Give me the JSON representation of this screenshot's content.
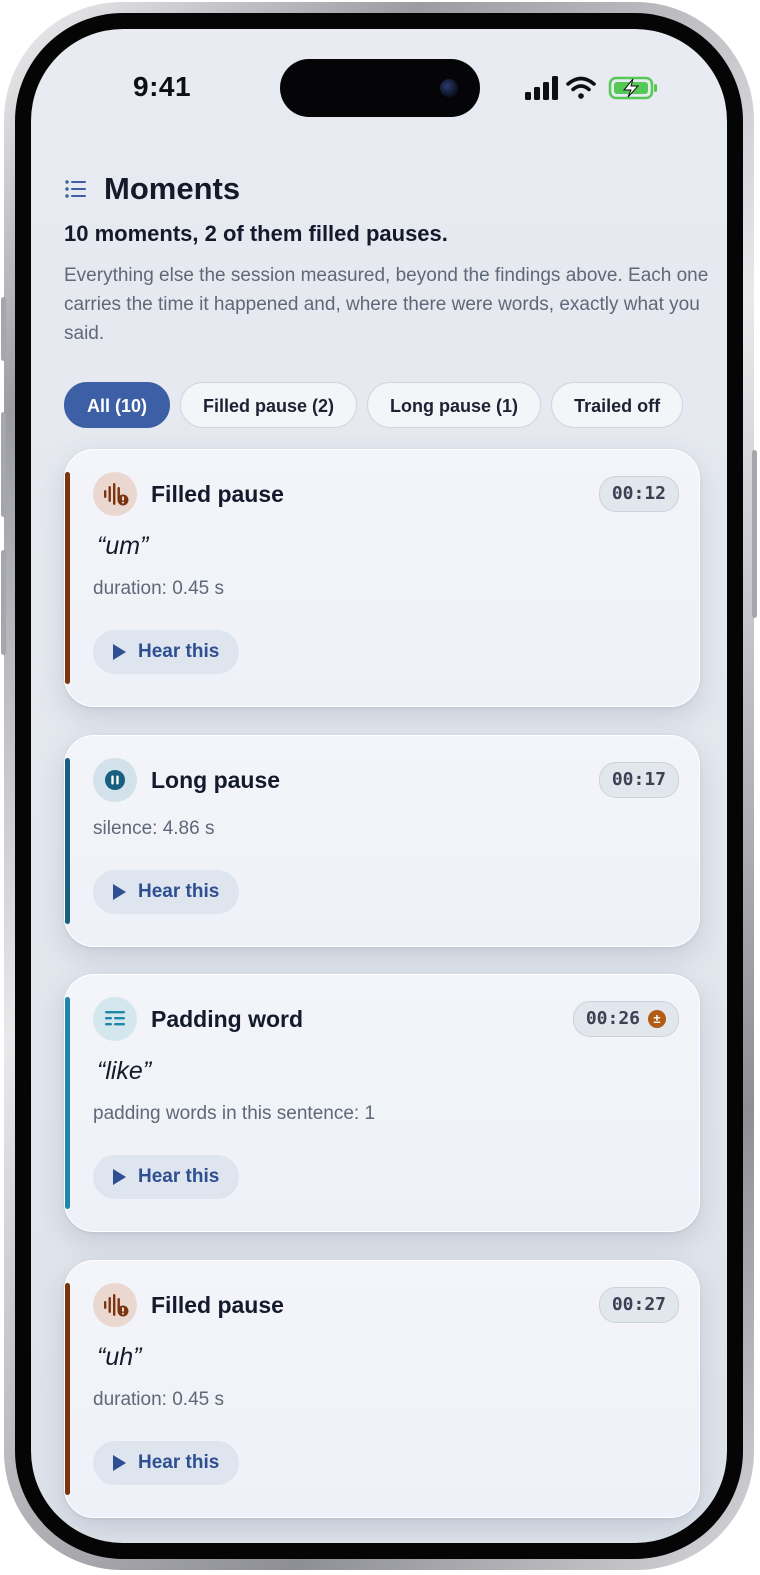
{
  "status_bar": {
    "time": "9:41"
  },
  "header": {
    "title": "Moments",
    "subtitle": "10 moments, 2 of them filled pauses.",
    "description": "Everything else the session measured, beyond the findings above. Each one carries the time it happened and, where there were words, exactly what you said."
  },
  "filters": [
    {
      "label": "All (10)",
      "active": true
    },
    {
      "label": "Filled pause (2)",
      "active": false
    },
    {
      "label": "Long pause (1)",
      "active": false
    },
    {
      "label": "Trailed off",
      "active": false
    }
  ],
  "moments": [
    {
      "kind": "Filled pause",
      "icon": "waveform-alert-icon",
      "accent": "#7a3410",
      "timestamp": "00:12",
      "quote": "“um”",
      "detail": "duration: 0.45 s",
      "action": "Hear this"
    },
    {
      "kind": "Long pause",
      "icon": "pause-icon",
      "accent": "#17607f",
      "timestamp": "00:17",
      "quote": "",
      "detail": "silence: 4.86 s",
      "action": "Hear this"
    },
    {
      "kind": "Padding word",
      "icon": "text-wrap-icon",
      "accent": "#1e86a8",
      "timestamp": "00:26",
      "flag": "±",
      "quote": "“like”",
      "detail": "padding words in this sentence: 1",
      "action": "Hear this"
    },
    {
      "kind": "Filled pause",
      "icon": "waveform-alert-icon",
      "accent": "#7a3410",
      "timestamp": "00:27",
      "quote": "“uh”",
      "detail": "duration: 0.45 s",
      "action": "Hear this"
    }
  ]
}
